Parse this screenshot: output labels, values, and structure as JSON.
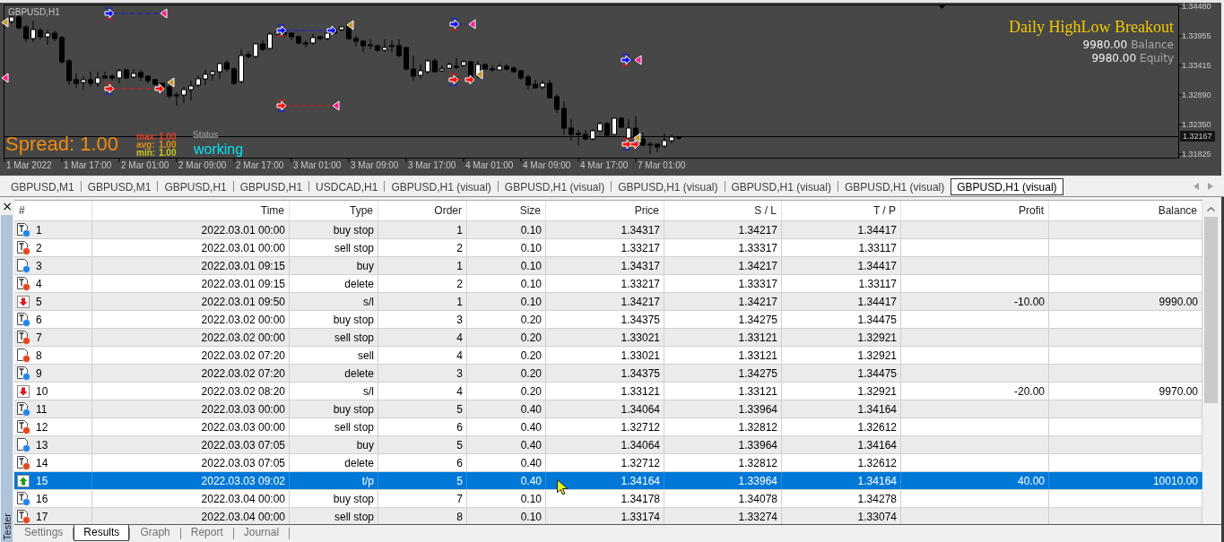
{
  "chart": {
    "symbol": "GBPUSD,H1",
    "expert": {
      "title": "Daily HighLow Breakout",
      "lines": [
        {
          "amount": "9980.00",
          "name": "Balance"
        },
        {
          "amount": "9980.00",
          "name": "Equity"
        }
      ]
    },
    "spread": {
      "label": "Spread: 1.00",
      "stats": [
        {
          "label": "max:",
          "value": "1.00",
          "color": "#e8401c"
        },
        {
          "label": "avg:",
          "value": "1.00",
          "color": "#e0901c"
        },
        {
          "label": "min:",
          "value": "1.00",
          "color": "#c8c81e"
        }
      ]
    },
    "status": {
      "label": "Status",
      "value": "working"
    },
    "price_axis": {
      "ticks": [
        "1.34480",
        "1.33955",
        "1.33415",
        "1.32890",
        "1.32350",
        "1.31825"
      ],
      "current": "1.32167"
    },
    "time_axis": [
      "1 Mar 2022",
      "1 Mar 17:00",
      "2 Mar 01:00",
      "2 Mar 09:00",
      "2 Mar 17:00",
      "3 Mar 01:00",
      "3 Mar 09:00",
      "3 Mar 17:00",
      "4 Mar 01:00",
      "4 Mar 09:00",
      "4 Mar 17:00",
      "7 Mar 01:00"
    ]
  },
  "chart_tabs": [
    {
      "label": "GBPUSD,M1",
      "selected": false
    },
    {
      "label": "GBPUSD,M1",
      "selected": false
    },
    {
      "label": "GBPUSD,H1",
      "selected": false
    },
    {
      "label": "GBPUSD,H1",
      "selected": false
    },
    {
      "label": "USDCAD,H1",
      "selected": false
    },
    {
      "label": "GBPUSD,H1 (visual)",
      "selected": false
    },
    {
      "label": "GBPUSD,H1 (visual)",
      "selected": false
    },
    {
      "label": "GBPUSD,H1 (visual)",
      "selected": false
    },
    {
      "label": "GBPUSD,H1 (visual)",
      "selected": false
    },
    {
      "label": "GBPUSD,H1 (visual)",
      "selected": false
    },
    {
      "label": "GBPUSD,H1 (visual)",
      "selected": true
    }
  ],
  "panel": {
    "close": "×",
    "title": "Tester"
  },
  "table": {
    "columns": [
      "#",
      "Time",
      "Type",
      "Order",
      "Size",
      "Price",
      "S / L",
      "T / P",
      "Profit",
      "Balance"
    ],
    "rows": [
      {
        "kind": "pending_buy",
        "selected": false,
        "cells": [
          "1",
          "2022.03.01 00:00",
          "buy stop",
          "1",
          "0.10",
          "1.34317",
          "1.34217",
          "1.34417"
        ]
      },
      {
        "kind": "pending_sell",
        "selected": false,
        "cells": [
          "2",
          "2022.03.01 00:00",
          "sell stop",
          "2",
          "0.10",
          "1.33217",
          "1.33317",
          "1.33117"
        ]
      },
      {
        "kind": "buy",
        "selected": false,
        "cells": [
          "3",
          "2022.03.01 09:15",
          "buy",
          "1",
          "0.10",
          "1.34317",
          "1.34217",
          "1.34417"
        ]
      },
      {
        "kind": "pending_sell",
        "selected": false,
        "cells": [
          "4",
          "2022.03.01 09:15",
          "delete",
          "2",
          "0.10",
          "1.33217",
          "1.33317",
          "1.33117"
        ]
      },
      {
        "kind": "sl",
        "selected": false,
        "cells": [
          "5",
          "2022.03.01 09:50",
          "s/l",
          "1",
          "0.10",
          "1.34217",
          "1.34217",
          "1.34417",
          "-10.00",
          "9990.00"
        ]
      },
      {
        "kind": "pending_buy",
        "selected": false,
        "cells": [
          "6",
          "2022.03.02 00:00",
          "buy stop",
          "3",
          "0.20",
          "1.34375",
          "1.34275",
          "1.34475"
        ]
      },
      {
        "kind": "pending_sell",
        "selected": false,
        "cells": [
          "7",
          "2022.03.02 00:00",
          "sell stop",
          "4",
          "0.20",
          "1.33021",
          "1.33121",
          "1.32921"
        ]
      },
      {
        "kind": "sell",
        "selected": false,
        "cells": [
          "8",
          "2022.03.02 07:20",
          "sell",
          "4",
          "0.20",
          "1.33021",
          "1.33121",
          "1.32921"
        ]
      },
      {
        "kind": "pending_buy",
        "selected": false,
        "cells": [
          "9",
          "2022.03.02 07:20",
          "delete",
          "3",
          "0.20",
          "1.34375",
          "1.34275",
          "1.34475"
        ]
      },
      {
        "kind": "sl",
        "selected": false,
        "cells": [
          "10",
          "2022.03.02 08:20",
          "s/l",
          "4",
          "0.20",
          "1.33121",
          "1.33121",
          "1.32921",
          "-20.00",
          "9970.00"
        ]
      },
      {
        "kind": "pending_buy",
        "selected": false,
        "cells": [
          "11",
          "2022.03.03 00:00",
          "buy stop",
          "5",
          "0.40",
          "1.34064",
          "1.33964",
          "1.34164"
        ]
      },
      {
        "kind": "pending_sell",
        "selected": false,
        "cells": [
          "12",
          "2022.03.03 00:00",
          "sell stop",
          "6",
          "0.40",
          "1.32712",
          "1.32812",
          "1.32612"
        ]
      },
      {
        "kind": "buy",
        "selected": false,
        "cells": [
          "13",
          "2022.03.03 07:05",
          "buy",
          "5",
          "0.40",
          "1.34064",
          "1.33964",
          "1.34164"
        ]
      },
      {
        "kind": "pending_sell",
        "selected": false,
        "cells": [
          "14",
          "2022.03.03 07:05",
          "delete",
          "6",
          "0.40",
          "1.32712",
          "1.32812",
          "1.32612"
        ]
      },
      {
        "kind": "tp",
        "selected": true,
        "cells": [
          "15",
          "2022.03.03 09:02",
          "t/p",
          "5",
          "0.40",
          "1.34164",
          "1.33964",
          "1.34164",
          "40.00",
          "10010.00"
        ]
      },
      {
        "kind": "pending_buy",
        "selected": false,
        "cells": [
          "16",
          "2022.03.04 00:00",
          "buy stop",
          "7",
          "0.10",
          "1.34178",
          "1.34078",
          "1.34278"
        ]
      },
      {
        "kind": "pending_sell",
        "selected": false,
        "cells": [
          "17",
          "2022.03.04 00:00",
          "sell stop",
          "8",
          "0.10",
          "1.33174",
          "1.33274",
          "1.33074"
        ]
      }
    ]
  },
  "bottom_tabs": [
    {
      "label": "Settings",
      "selected": false
    },
    {
      "label": "Results",
      "selected": true
    },
    {
      "label": "Graph",
      "selected": false
    },
    {
      "label": "Report",
      "selected": false
    },
    {
      "label": "Journal",
      "selected": false
    }
  ]
}
